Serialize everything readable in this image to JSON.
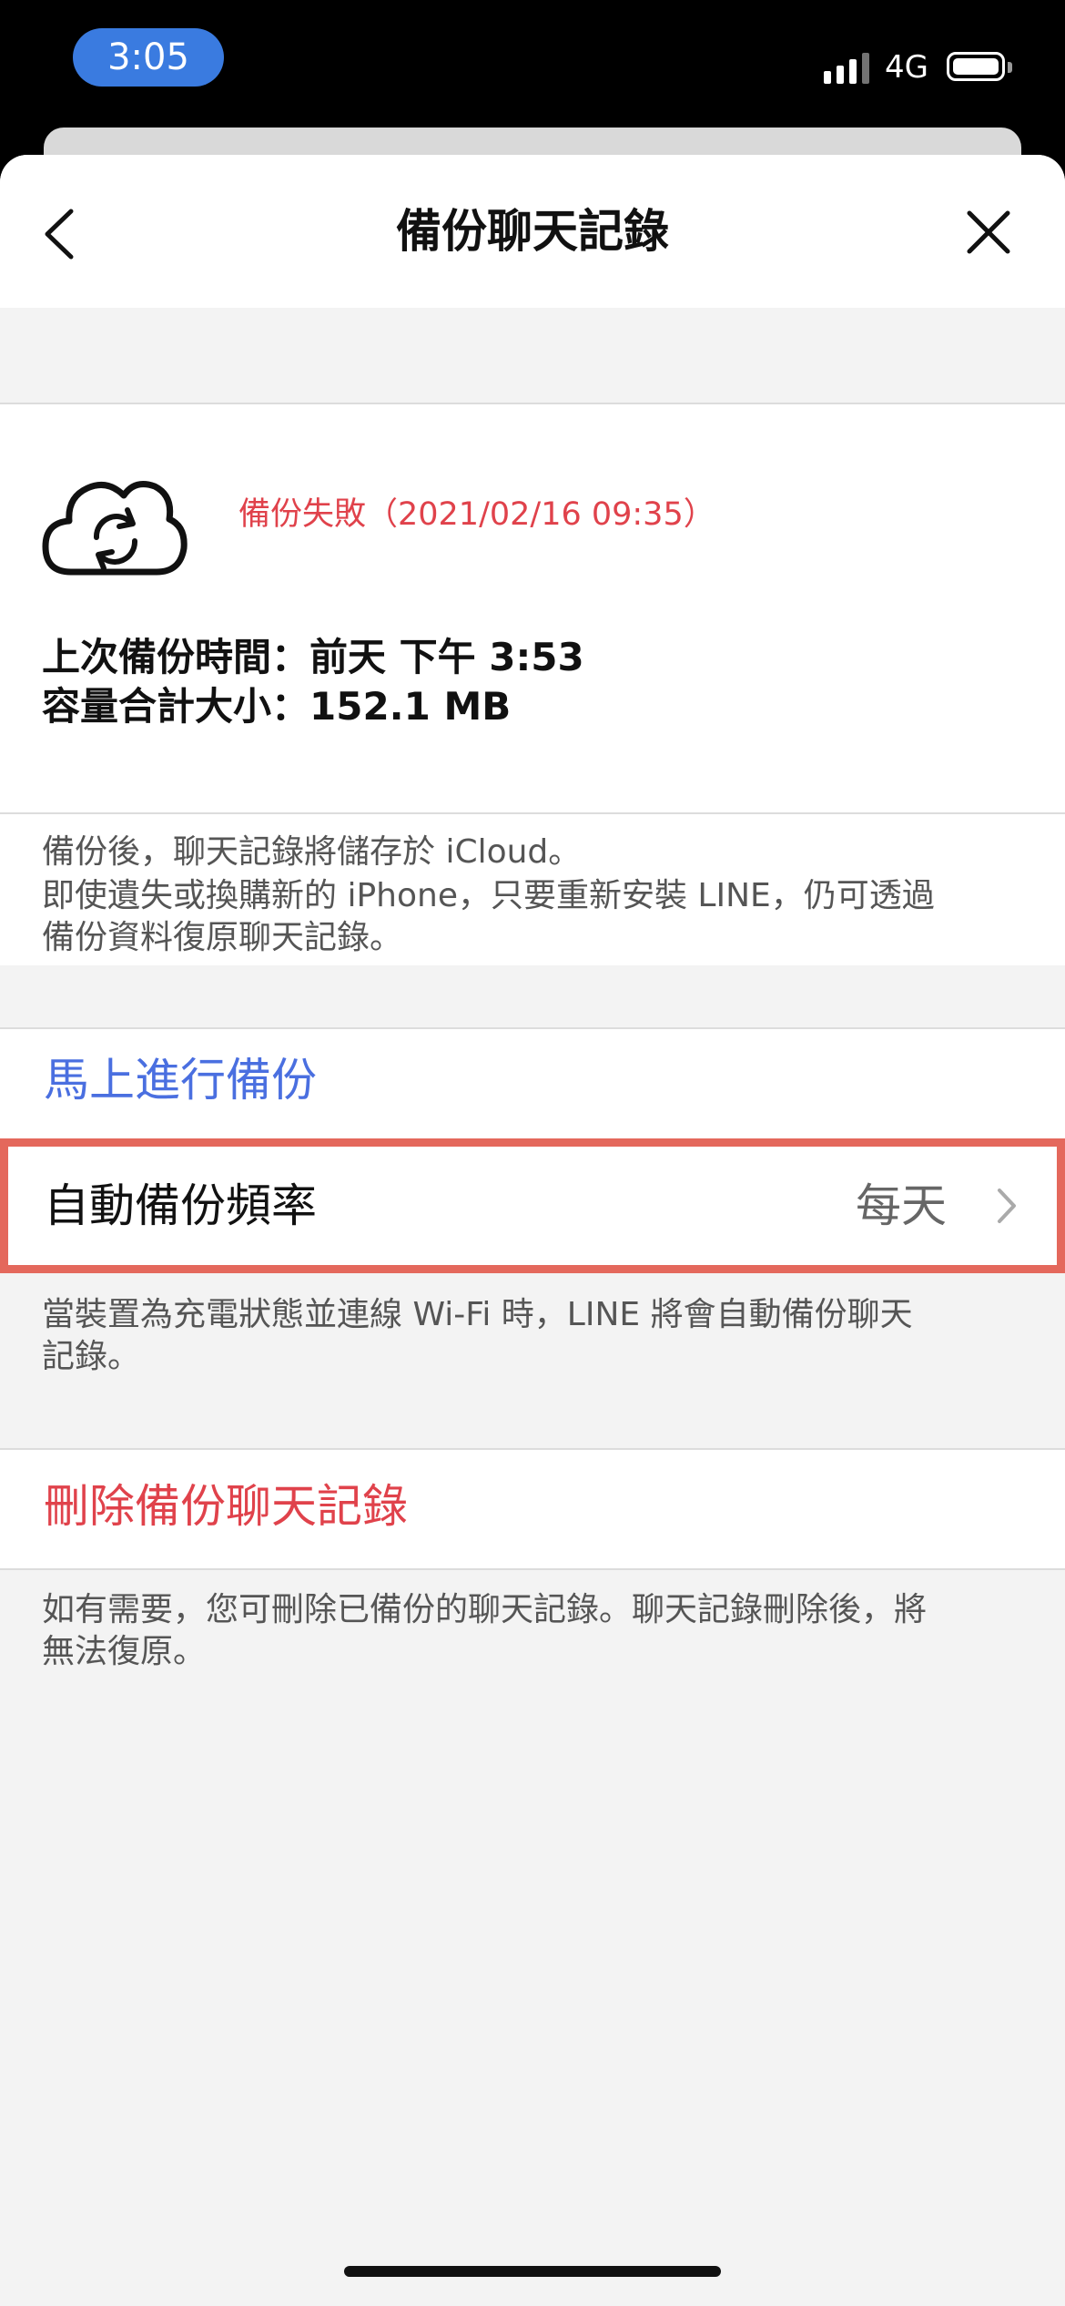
{
  "status_bar": {
    "time": "3:05",
    "network": "4G",
    "icons": [
      "signal-icon",
      "battery-icon"
    ]
  },
  "header": {
    "title": "備份聊天記錄",
    "icons": [
      "chevron-left-icon",
      "close-icon"
    ]
  },
  "backup_status": {
    "icon": "cloud-sync-icon",
    "status_text": "備份失敗（2021/02/16 09:35）",
    "last_backup_line": "上次備份時間：前天 下午 3:53",
    "total_size_line": "容量合計大小：152.1 MB"
  },
  "icloud_note": {
    "line1": "備份後，聊天記錄將儲存於 iCloud。",
    "line2": "即使遺失或換購新的 iPhone，只要重新安裝 LINE，仍可透過",
    "line3": "備份資料復原聊天記錄。"
  },
  "backup_now": {
    "label": "馬上進行備份",
    "color": "#4a6fe0"
  },
  "auto_backup": {
    "label": "自動備份頻率",
    "value": "每天",
    "icon": "chevron-right-icon",
    "highlight_color": "#e4685c"
  },
  "auto_backup_note": {
    "line1": "當裝置為充電狀態並連線 Wi-Fi 時，LINE 將會自動備份聊天",
    "line2": "記錄。"
  },
  "delete_backup": {
    "label": "刪除備份聊天記錄",
    "color": "#e0424b"
  },
  "delete_note": {
    "line1": "如有需要，您可刪除已備份的聊天記錄。聊天記錄刪除後，將",
    "line2": "無法復原。"
  }
}
